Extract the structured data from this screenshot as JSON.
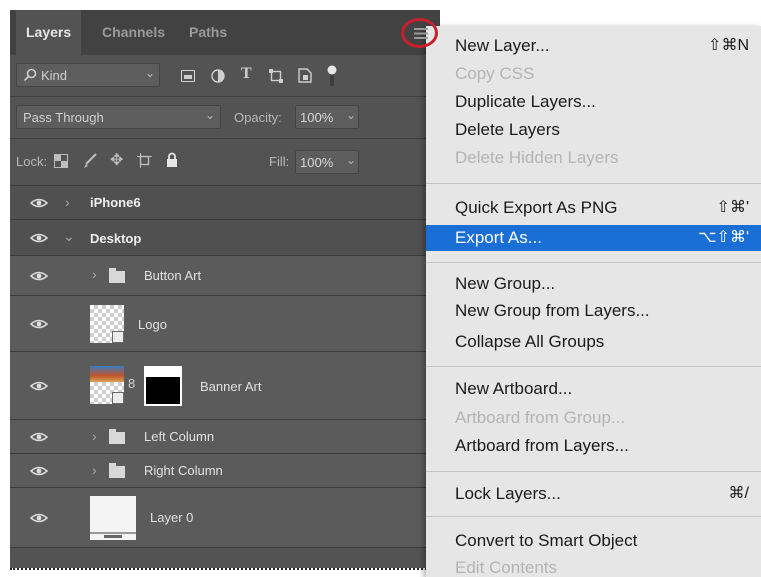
{
  "panel": {
    "tabs": [
      "Layers",
      "Channels",
      "Paths"
    ],
    "filter": {
      "label": "Kind"
    },
    "blend_mode": "Pass Through",
    "opacity": {
      "label": "Opacity:",
      "value": "100%"
    },
    "lock_label": "Lock:",
    "fill": {
      "label": "Fill:",
      "value": "100%"
    },
    "layers": [
      {
        "name": "iPhone6",
        "kind": "artboard",
        "expanded": false
      },
      {
        "name": "Desktop",
        "kind": "artboard",
        "expanded": true
      },
      {
        "name": "Button Art",
        "kind": "group",
        "expanded": false
      },
      {
        "name": "Logo",
        "kind": "smart-object"
      },
      {
        "name": "Banner Art",
        "kind": "masked-smart-object"
      },
      {
        "name": "Left Column",
        "kind": "group",
        "expanded": false
      },
      {
        "name": "Right Column",
        "kind": "group",
        "expanded": false
      },
      {
        "name": "Layer 0",
        "kind": "layer"
      }
    ]
  },
  "menu": {
    "items": [
      {
        "label": "New Layer...",
        "shortcut": "⇧⌘N",
        "enabled": true
      },
      {
        "label": "Copy CSS",
        "shortcut": "",
        "enabled": false
      },
      {
        "label": "Duplicate Layers...",
        "shortcut": "",
        "enabled": true
      },
      {
        "label": "Delete Layers",
        "shortcut": "",
        "enabled": true
      },
      {
        "label": "Delete Hidden Layers",
        "shortcut": "",
        "enabled": false
      },
      {
        "label": "Quick Export As PNG",
        "shortcut": "⇧⌘'",
        "enabled": true
      },
      {
        "label": "Export As...",
        "shortcut": "⌥⇧⌘'",
        "enabled": true,
        "highlighted": true
      },
      {
        "label": "New Group...",
        "shortcut": "",
        "enabled": true
      },
      {
        "label": "New Group from Layers...",
        "shortcut": "",
        "enabled": true
      },
      {
        "label": "Collapse All Groups",
        "shortcut": "",
        "enabled": true
      },
      {
        "label": "New Artboard...",
        "shortcut": "",
        "enabled": true
      },
      {
        "label": "Artboard from Group...",
        "shortcut": "",
        "enabled": false
      },
      {
        "label": "Artboard from Layers...",
        "shortcut": "",
        "enabled": true
      },
      {
        "label": "Lock Layers...",
        "shortcut": "⌘/",
        "enabled": true
      },
      {
        "label": "Convert to Smart Object",
        "shortcut": "",
        "enabled": true
      },
      {
        "label": "Edit Contents",
        "shortcut": "",
        "enabled": false
      }
    ]
  },
  "colors": {
    "panel_bg": "#535353",
    "menu_bg": "#e6e6e6",
    "menu_highlight": "#1a6fd6",
    "annotation_circle": "#c8202a"
  }
}
